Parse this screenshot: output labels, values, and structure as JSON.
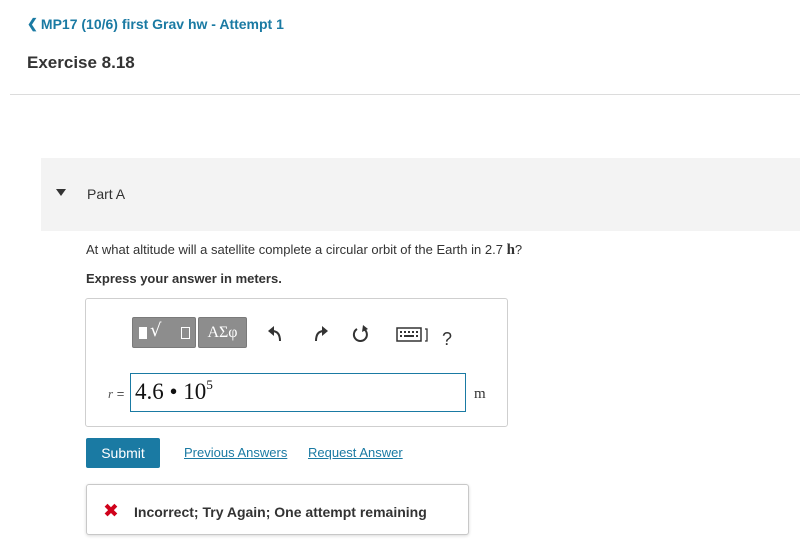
{
  "header": {
    "back_link": "MP17 (10/6) first Grav hw - Attempt 1",
    "exercise_title": "Exercise 8.18"
  },
  "part": {
    "label": "Part A",
    "question_prefix": "At what altitude will a satellite complete a circular orbit of the Earth in 2.7",
    "question_unit": "h",
    "question_suffix": "?",
    "instruction": "Express your answer in meters."
  },
  "toolbar": {
    "symbols_label": "ΑΣφ",
    "help_label": "?",
    "icons": [
      "templates-icon",
      "greek-symbols-icon",
      "undo-icon",
      "redo-icon",
      "reset-icon",
      "keyboard-icon",
      "help-icon"
    ]
  },
  "answer": {
    "variable": "r",
    "equals": "=",
    "value_mantissa": "4.6 • 10",
    "value_exponent": "5",
    "unit": "m"
  },
  "actions": {
    "submit_label": "Submit",
    "previous_answers_label": "Previous Answers",
    "request_answer_label": "Request Answer"
  },
  "feedback": {
    "text": "Incorrect; Try Again; One attempt remaining",
    "status_color": "#d0021b"
  },
  "colors": {
    "accent": "#1a7aa3",
    "tool_button": "#8d8d8d",
    "part_header_bg": "#f3f3f3"
  }
}
